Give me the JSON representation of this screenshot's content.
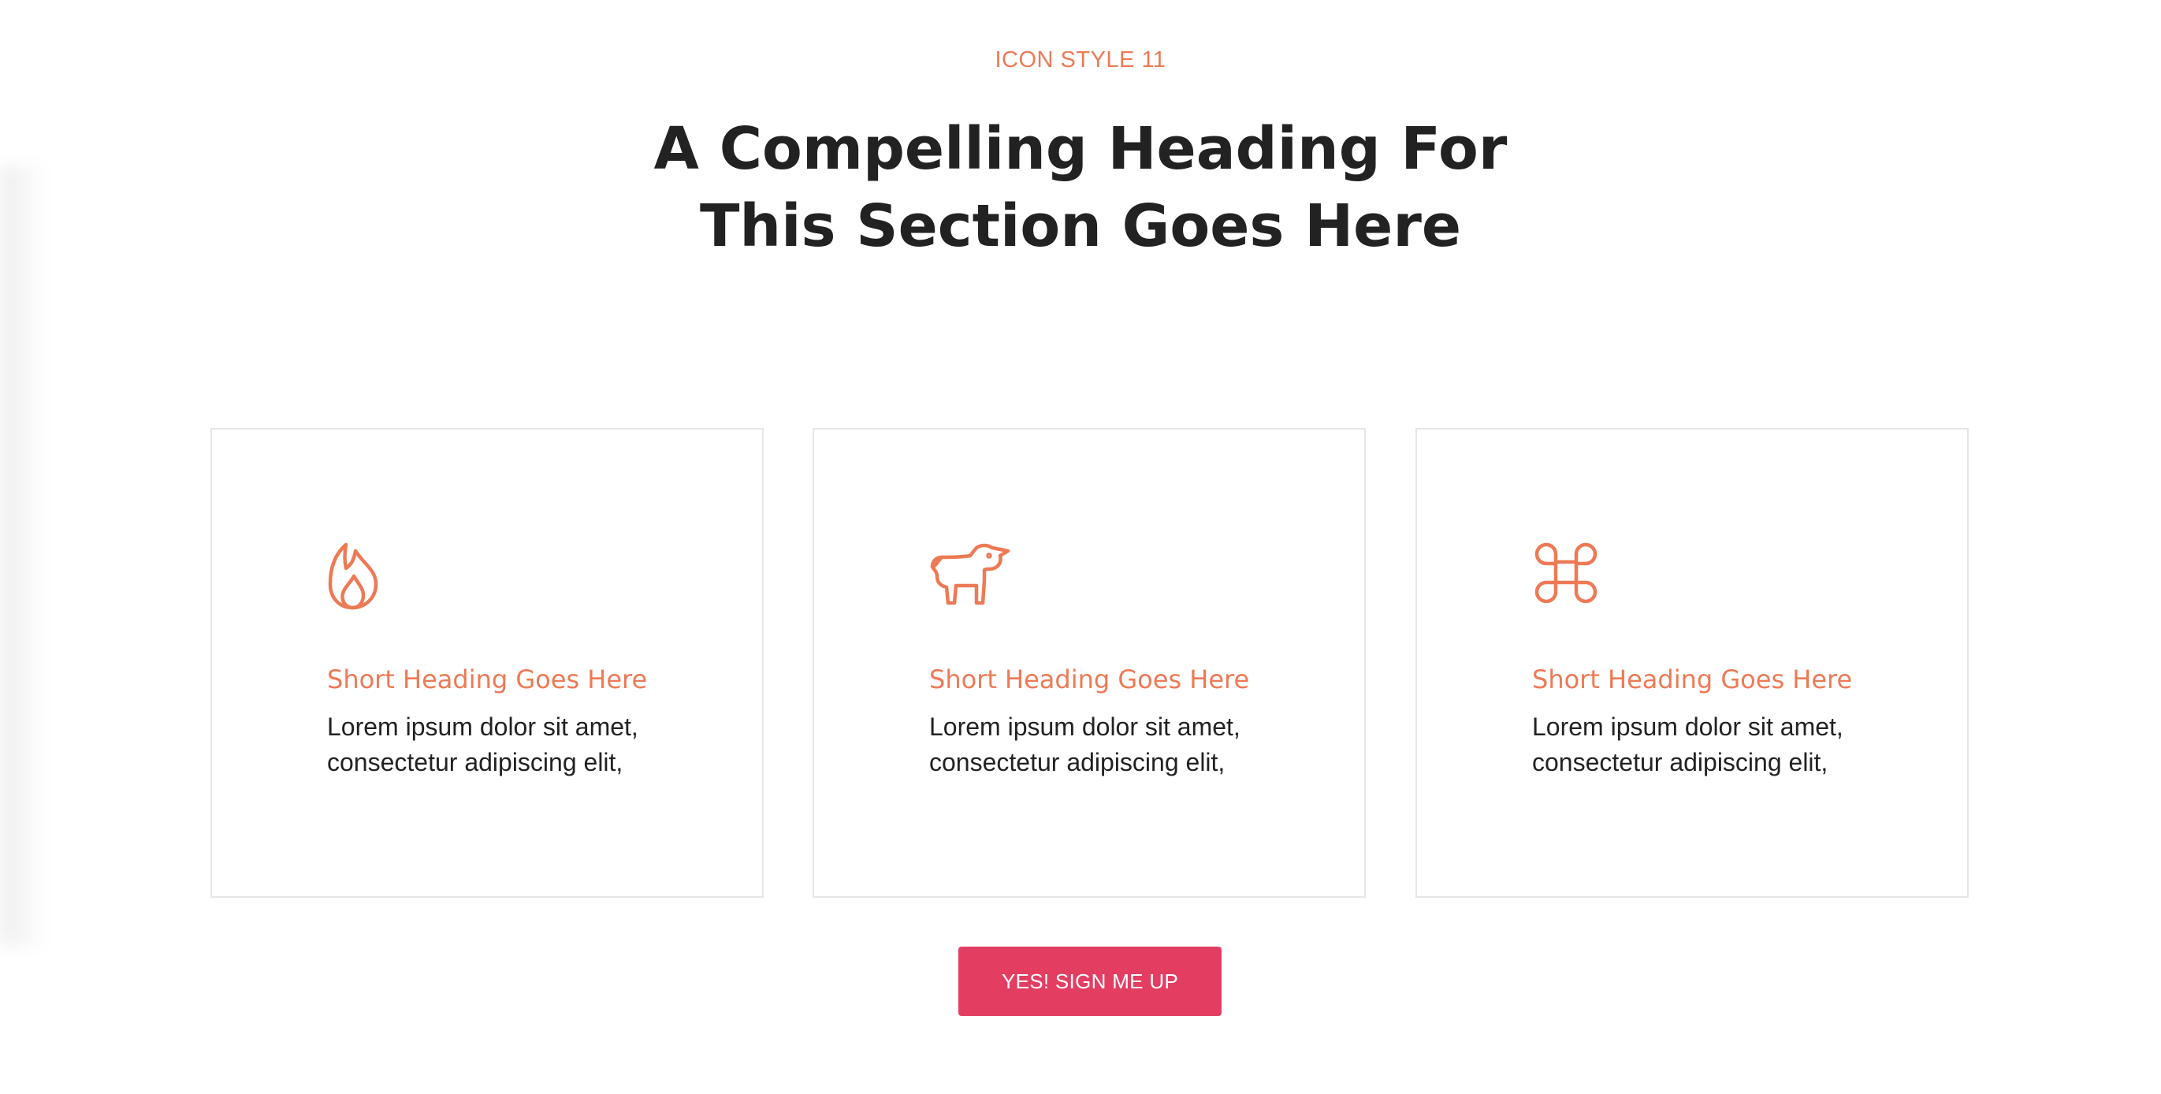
{
  "colors": {
    "accent": "#ED7A55",
    "heading": "#222222",
    "body": "#222222",
    "button_bg": "#E33E62",
    "card_border": "#E6E6E6"
  },
  "header": {
    "eyebrow": "ICON STYLE 11",
    "title_line1": "A Compelling Heading For",
    "title_line2": "This Section Goes Here"
  },
  "cards": [
    {
      "icon": "fire-icon",
      "title": "Short Heading Goes Here",
      "body_line1": "Lorem ipsum dolor sit amet,",
      "body_line2": "consectetur adipiscing elit,"
    },
    {
      "icon": "unicorn-icon",
      "title": "Short Heading Goes Here",
      "body_line1": "Lorem ipsum dolor sit amet,",
      "body_line2": "consectetur adipiscing elit,"
    },
    {
      "icon": "command-key-icon",
      "title": "Short Heading Goes Here",
      "body_line1": "Lorem ipsum dolor sit amet,",
      "body_line2": "consectetur adipiscing elit,"
    }
  ],
  "cta": {
    "label": "YES! SIGN ME UP"
  }
}
